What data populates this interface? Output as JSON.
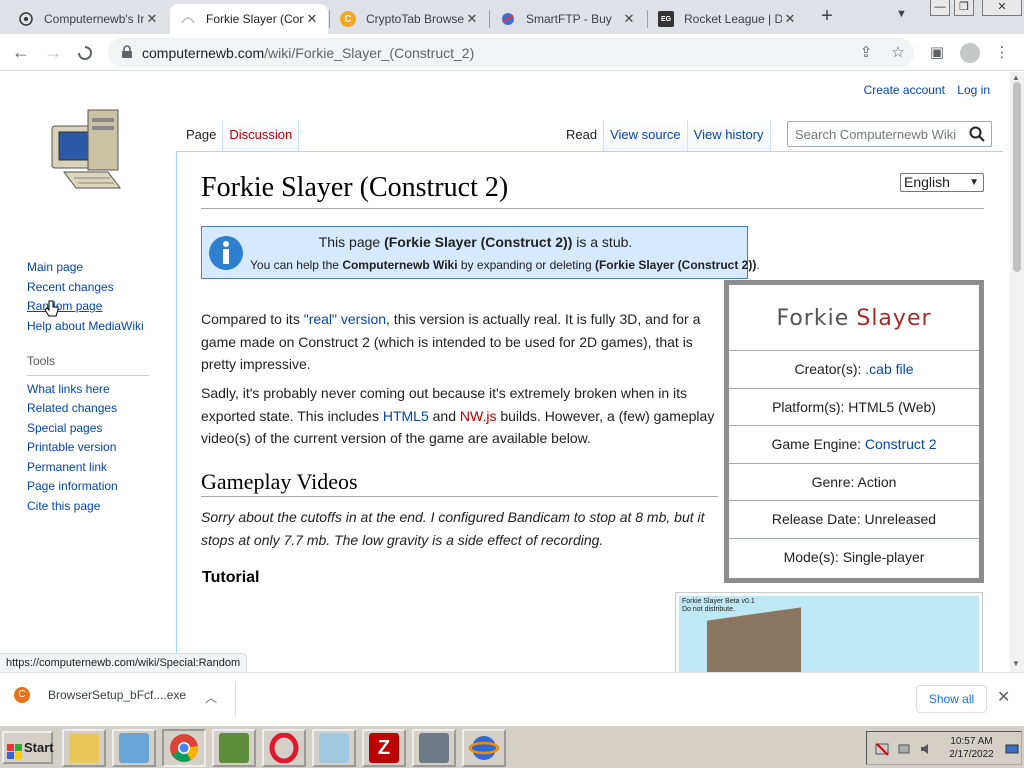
{
  "browser": {
    "tabs": [
      {
        "title": "Computernewb's In",
        "favicon": "puzzle-icon",
        "active": false
      },
      {
        "title": "Forkie Slayer (Cons",
        "favicon": "wiki-icon",
        "active": true
      },
      {
        "title": "CryptoTab Browser",
        "favicon": "cryptotab-icon",
        "active": false
      },
      {
        "title": "SmartFTP - Buy",
        "favicon": "smartftp-icon",
        "active": false
      },
      {
        "title": "Rocket League | Do",
        "favicon": "epic-icon",
        "active": false
      }
    ],
    "new_tab": "+",
    "url_host": "computernewb.com",
    "url_path": "/wiki/Forkie_Slayer_(Construct_2)"
  },
  "wiki": {
    "personal": {
      "create_account": "Create account",
      "log_in": "Log in"
    },
    "nav": {
      "main": [
        "Main page",
        "Recent changes",
        "Random page",
        "Help about MediaWiki"
      ],
      "tools_heading": "Tools",
      "tools": [
        "What links here",
        "Related changes",
        "Special pages",
        "Printable version",
        "Permanent link",
        "Page information",
        "Cite this page"
      ]
    },
    "tabs": {
      "page": "Page",
      "discussion": "Discussion",
      "read": "Read",
      "view_source": "View source",
      "view_history": "View history"
    },
    "search_placeholder": "Search Computernewb Wiki",
    "title": "Forkie Slayer (Construct 2)",
    "language": "English",
    "stub": {
      "pre": "This page ",
      "bold": "(Forkie Slayer (Construct 2))",
      "post": " is a stub.",
      "l2_a": "You can help the ",
      "l2_b": "Computernewb Wiki",
      "l2_c": " by expanding or deleting ",
      "l2_d": "(Forkie Slayer (Construct 2))",
      "l2_e": "."
    },
    "infobox": {
      "logo_word1": "Forkie",
      "logo_word2": "Slayer",
      "creator_label": "Creator(s): ",
      "creator_value": ".cab file",
      "platform": "Platform(s): HTML5 (Web)",
      "engine_label": "Game Engine: ",
      "engine_value": "Construct 2",
      "genre": "Genre: Action",
      "release": "Release Date: Unreleased",
      "mode": "Mode(s): Single-player"
    },
    "p1": {
      "a": "Compared to its ",
      "link": "\"real\" version",
      "b": ", this version is actually real. It is fully 3D, and for a game made on Construct 2 (which is intended to be used for 2D games), that is pretty impressive."
    },
    "p2": {
      "a": "Sadly, it's probably never coming out because it's extremely broken when in its exported state. This includes ",
      "html5": "HTML5",
      "b": " and ",
      "nwjs": "NW.js",
      "c": " builds. However, a (few) gameplay video(s) of the current version of the game are available below."
    },
    "h2": "Gameplay Videos",
    "p3": "Sorry about the cutoffs in at the end. I configured Bandicam to stop at 8 mb, but it stops at only 7.7 mb. The low gravity is a side effect of recording.",
    "h3": "Tutorial",
    "thumb_caption_1": "Forkie Slayer Beta v0.1",
    "thumb_caption_2": "Do not distribute."
  },
  "status_url": "https://computernewb.com/wiki/Special:Random",
  "download": {
    "filename": "BrowserSetup_bFcf....exe",
    "show_all": "Show all"
  },
  "taskbar": {
    "start": "Start",
    "apps": [
      "file-manager-icon",
      "media-player-icon",
      "chrome-icon",
      "minecraft-icon",
      "opera-icon",
      "notepad-icon",
      "filezilla-icon",
      "network-tool-icon",
      "browser-globe-icon"
    ],
    "time": "10:57 AM",
    "date": "2/17/2022"
  }
}
